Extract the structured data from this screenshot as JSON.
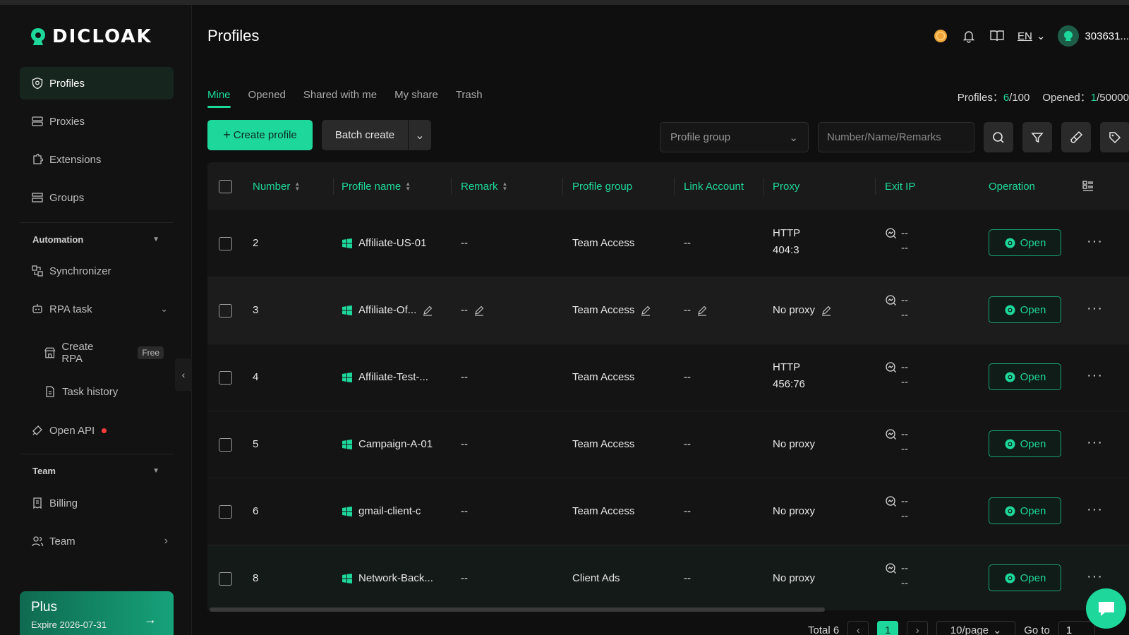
{
  "brand": {
    "name": "DICLOAK",
    "accent": "#1ed89b"
  },
  "sidebar": {
    "items": [
      {
        "label": "Profiles",
        "icon": "shield-icon"
      },
      {
        "label": "Proxies",
        "icon": "proxy-icon"
      },
      {
        "label": "Extensions",
        "icon": "extension-icon"
      },
      {
        "label": "Groups",
        "icon": "groups-icon"
      }
    ],
    "automation": {
      "title": "Automation",
      "items": [
        {
          "label": "Synchronizer",
          "icon": "sync-icon"
        },
        {
          "label": "RPA task",
          "icon": "robot-icon"
        },
        {
          "label": "Create RPA",
          "icon": "store-icon",
          "badge": "Free"
        },
        {
          "label": "Task history",
          "icon": "document-icon"
        },
        {
          "label": "Open API",
          "icon": "api-icon"
        }
      ]
    },
    "team": {
      "title": "Team",
      "items": [
        {
          "label": "Billing",
          "icon": "billing-icon"
        },
        {
          "label": "Team",
          "icon": "users-icon"
        }
      ]
    },
    "plan": {
      "title": "Plus",
      "expire": "Expire 2026-07-31"
    }
  },
  "header": {
    "title": "Profiles",
    "lang": "EN",
    "user": "303631..."
  },
  "tabs": [
    "Mine",
    "Opened",
    "Shared with me",
    "My share",
    "Trash"
  ],
  "counts": {
    "profiles_label": "Profiles：",
    "profiles_used": "6",
    "profiles_total": "/100",
    "opened_label": "Opened：",
    "opened_used": "1",
    "opened_total": "/50000"
  },
  "toolbar": {
    "create_label": "Create profile",
    "batch_label": "Batch create",
    "group_placeholder": "Profile group",
    "search_placeholder": "Number/Name/Remarks"
  },
  "table": {
    "columns": [
      "Number",
      "Profile name",
      "Remark",
      "Profile group",
      "Link Account",
      "Proxy",
      "Exit IP",
      "Operation"
    ],
    "open_label": "Open",
    "rows": [
      {
        "number": "2",
        "name": "Affiliate-US-01",
        "remark": "--",
        "group": "Team Access",
        "link": "--",
        "proxy1": "HTTP",
        "proxy2": "404:3",
        "exit1": "--",
        "exit2": "--"
      },
      {
        "number": "3",
        "name": "Affiliate-Of...",
        "remark": "--",
        "group": "Team Access",
        "link": "--",
        "proxy1": "No proxy",
        "proxy2": "",
        "exit1": "--",
        "exit2": "--"
      },
      {
        "number": "4",
        "name": "Affiliate-Test-...",
        "remark": "--",
        "group": "Team Access",
        "link": "--",
        "proxy1": "HTTP",
        "proxy2": "456:76",
        "exit1": "--",
        "exit2": "--"
      },
      {
        "number": "5",
        "name": "Campaign-A-01",
        "remark": "--",
        "group": "Team Access",
        "link": "--",
        "proxy1": "No proxy",
        "proxy2": "",
        "exit1": "--",
        "exit2": "--"
      },
      {
        "number": "6",
        "name": "gmail-client-c",
        "remark": "--",
        "group": "Team Access",
        "link": "--",
        "proxy1": "No proxy",
        "proxy2": "",
        "exit1": "--",
        "exit2": "--"
      },
      {
        "number": "8",
        "name": "Network-Back...",
        "remark": "--",
        "group": "Client Ads",
        "link": "--",
        "proxy1": "No proxy",
        "proxy2": "",
        "exit1": "--",
        "exit2": "--"
      }
    ]
  },
  "pagination": {
    "total": "Total 6",
    "page": "1",
    "page_size": "10/page",
    "goto_label": "Go to",
    "goto_value": "1"
  }
}
